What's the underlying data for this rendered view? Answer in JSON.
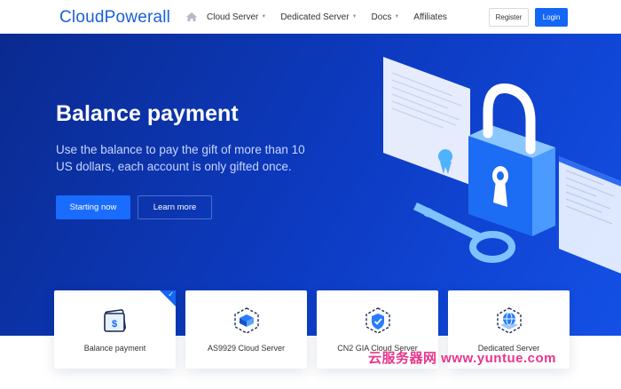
{
  "header": {
    "logo": "CloudPowerall",
    "nav": [
      {
        "label": "Cloud Server",
        "has_caret": true
      },
      {
        "label": "Dedicated Server",
        "has_caret": true
      },
      {
        "label": "Docs",
        "has_caret": true
      },
      {
        "label": "Affiliates",
        "has_caret": false
      }
    ],
    "register_label": "Register",
    "login_label": "Login"
  },
  "hero": {
    "title": "Balance payment",
    "subtitle": "Use the balance to pay the gift of more than 10 US dollars, each account is only gifted once.",
    "primary_button": "Starting now",
    "secondary_button": "Learn more"
  },
  "cards": [
    {
      "label": "Balance payment",
      "icon": "wallet-icon",
      "active": true
    },
    {
      "label": "AS9929 Cloud Server",
      "icon": "cloud-server-icon",
      "active": false
    },
    {
      "label": "CN2 GIA Cloud Server",
      "icon": "shield-check-icon",
      "active": false
    },
    {
      "label": "Dedicated Server",
      "icon": "globe-server-icon",
      "active": false
    }
  ],
  "watermark": "云服务器网 www.yuntue.com",
  "colors": {
    "brand": "#1466f5",
    "hero_dark": "#0a2a8f",
    "hero_light": "#1450e6",
    "logo": "#1a5fd9"
  }
}
